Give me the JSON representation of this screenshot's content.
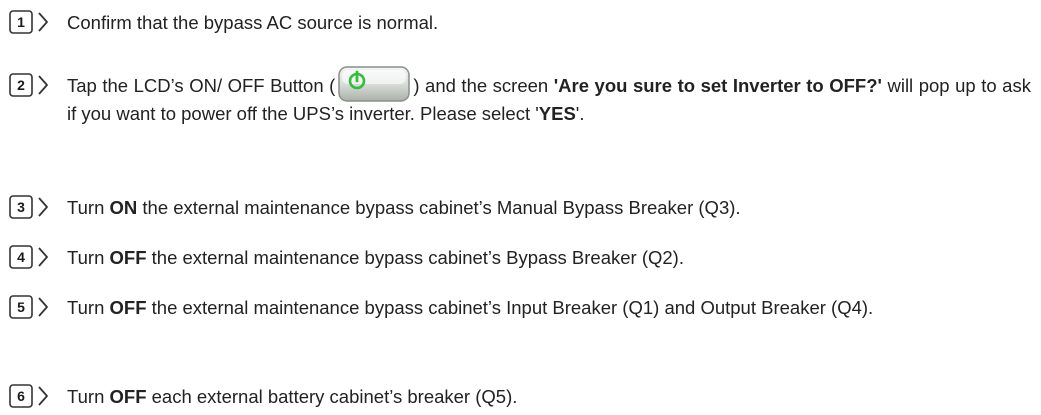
{
  "steps": [
    {
      "number": "1",
      "parts": {
        "t1": "Confirm that the bypass AC source is normal."
      }
    },
    {
      "number": "2",
      "parts": {
        "t1": "Tap the LCD’s ON/ OFF Button (",
        "t2": ") and the screen ",
        "b1": "'Are you sure to set Inverter to OFF?'",
        "t3": " will pop up to ask if you want to power off the UPS’s inverter. Please select '",
        "b2": "YES",
        "t4": "'."
      },
      "button_icon": "power-icon",
      "button_icon_color": "#2fbf3a"
    },
    {
      "number": "3",
      "parts": {
        "t1": "Turn ",
        "b1": "ON",
        "t2": " the external maintenance bypass cabinet’s Manual Bypass Breaker (Q3)."
      }
    },
    {
      "number": "4",
      "parts": {
        "t1": "Turn ",
        "b1": "OFF",
        "t2": " the external maintenance bypass cabinet’s Bypass Breaker (Q2)."
      }
    },
    {
      "number": "5",
      "parts": {
        "t1": "Turn ",
        "b1": "OFF",
        "t2": " the external maintenance bypass cabinet’s Input Breaker (Q1) and Output Breaker (Q4)."
      }
    },
    {
      "number": "6",
      "parts": {
        "t1": "Turn ",
        "b1": "OFF",
        "t2": " each external battery cabinet’s breaker (Q5)."
      }
    }
  ]
}
